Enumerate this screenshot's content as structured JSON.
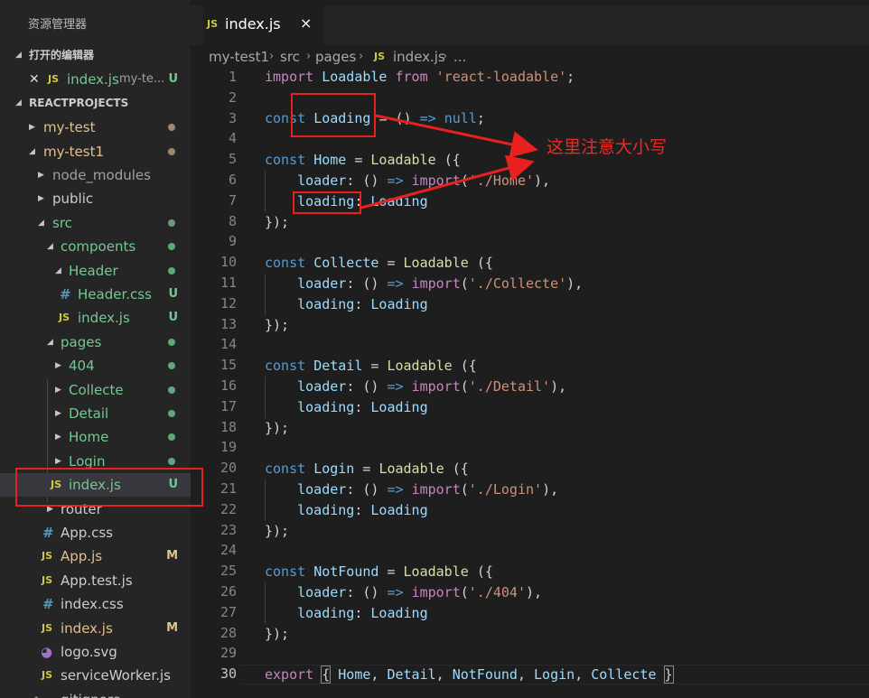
{
  "sidebar": {
    "title": "资源管理器",
    "open_editors_label": "打开的编辑器",
    "open_editor": {
      "icon": "JS",
      "name": "index.js",
      "path": "my-te...",
      "status": "U"
    },
    "project_label": "REACTPROJECTS",
    "tree": [
      {
        "name": "my-test",
        "status": "dot"
      },
      {
        "name": "my-test1",
        "status": "dot"
      },
      {
        "name": "node_modules"
      },
      {
        "name": "public"
      },
      {
        "name": "src",
        "status": "dot"
      },
      {
        "name": "compoents",
        "status": "dot"
      },
      {
        "name": "Header",
        "status": "dot"
      },
      {
        "icon": "#",
        "name": "Header.css",
        "status": "U"
      },
      {
        "icon": "JS",
        "name": "index.js",
        "status": "U"
      },
      {
        "name": "pages",
        "status": "dot"
      },
      {
        "name": "404",
        "status": "dot"
      },
      {
        "name": "Collecte",
        "status": "dot"
      },
      {
        "name": "Detail",
        "status": "dot"
      },
      {
        "name": "Home",
        "status": "dot"
      },
      {
        "name": "Login",
        "status": "dot"
      },
      {
        "icon": "JS",
        "name": "index.js",
        "status": "U"
      },
      {
        "name": "router"
      },
      {
        "icon": "#",
        "name": "App.css"
      },
      {
        "icon": "JS",
        "name": "App.js",
        "status": "M"
      },
      {
        "icon": "JS",
        "name": "App.test.js"
      },
      {
        "icon": "#",
        "name": "index.css"
      },
      {
        "icon": "JS",
        "name": "index.js",
        "status": "M"
      },
      {
        "icon": "svg",
        "name": "logo.svg"
      },
      {
        "icon": "JS",
        "name": "serviceWorker.js"
      },
      {
        "name": "gitignore"
      }
    ]
  },
  "tab": {
    "icon": "JS",
    "name": "index.js",
    "close": "×"
  },
  "breadcrumb": {
    "items": [
      "my-test1",
      "src",
      "pages"
    ],
    "file_icon": "JS",
    "file": "index.js",
    "more": "..."
  },
  "editor": {
    "line_numbers": [
      "1",
      "2",
      "3",
      "4",
      "5",
      "6",
      "7",
      "8",
      "9",
      "10",
      "11",
      "12",
      "13",
      "14",
      "15",
      "16",
      "17",
      "18",
      "19",
      "20",
      "21",
      "22",
      "23",
      "24",
      "25",
      "26",
      "27",
      "28",
      "29",
      "30"
    ],
    "active_line": "30"
  },
  "annotation": {
    "note": "这里注意大小写"
  },
  "colors": {
    "accent_red": "#e8211e",
    "git_untracked": "#73c991",
    "git_modified": "#e2c08d"
  }
}
